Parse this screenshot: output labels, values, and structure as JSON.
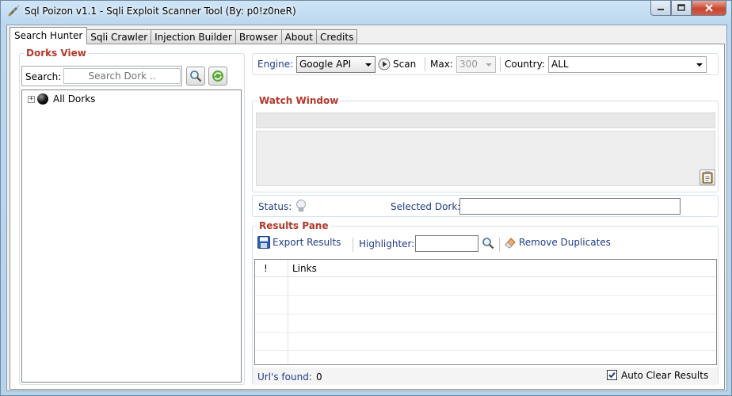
{
  "window": {
    "title": "Sql Poizon v1.1 - Sqli Exploit Scanner Tool (By: p0!z0neR)",
    "minimize_icon": "minimize-icon",
    "maximize_icon": "maximize-icon",
    "close_icon": "close-icon"
  },
  "tabs": [
    {
      "label": "Search Hunter",
      "active": true
    },
    {
      "label": "Sqli Crawler",
      "active": false
    },
    {
      "label": "Injection Builder",
      "active": false
    },
    {
      "label": "Browser",
      "active": false
    },
    {
      "label": "About",
      "active": false
    },
    {
      "label": "Credits",
      "active": false
    }
  ],
  "dorks": {
    "title": "Dorks View",
    "search_label": "Search:",
    "search_placeholder": "Search Dork ..",
    "search_icon": "magnifier-icon",
    "refresh_icon": "refresh-icon",
    "tree": [
      {
        "label": "All Dorks",
        "expander": "+",
        "icon": "black-ball-icon"
      }
    ]
  },
  "engine_bar": {
    "engine_label": "Engine:",
    "engine_value": "Google API",
    "scan_label": "Scan",
    "max_label": "Max:",
    "max_value": "300",
    "country_label": "Country:",
    "country_value": "ALL"
  },
  "watch": {
    "title": "Watch Window",
    "clipboard_icon": "clipboard-icon"
  },
  "status": {
    "status_label": "Status:",
    "status_icon": "lightbulb-icon",
    "selected_dork_label": "Selected Dork:",
    "selected_dork_value": ""
  },
  "results": {
    "title": "Results Pane",
    "export_label": "Export Results",
    "highlighter_label": "Highlighter:",
    "highlighter_value": "",
    "remove_duplicates_label": "Remove Duplicates",
    "columns": [
      "!",
      "Links"
    ],
    "rows": [],
    "urls_found_label": "Url's found:",
    "urls_found_value": "0",
    "auto_clear_label": "Auto Clear Results",
    "auto_clear_checked": true
  },
  "colors": {
    "group_title": "#b3382c",
    "label_blue": "#1f3c88",
    "frame": "#b6d3ec"
  }
}
